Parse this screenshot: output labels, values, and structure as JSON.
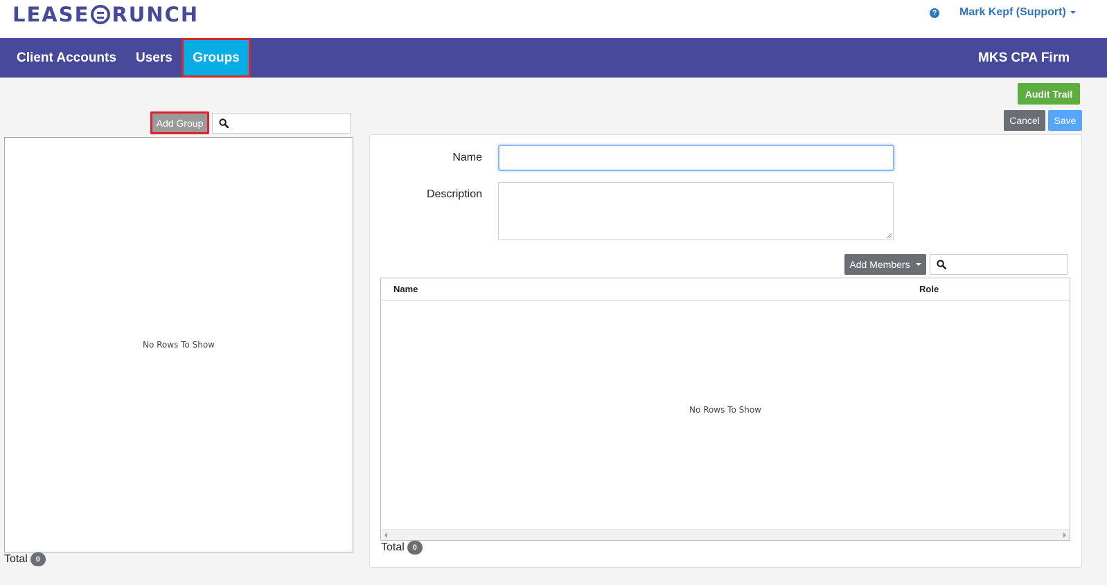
{
  "header": {
    "logo_left": "LEASE",
    "logo_right": "RUNCH",
    "help_icon": "question-circle-icon",
    "help_glyph": "?",
    "user_label": "Mark Kepf (Support)"
  },
  "nav": {
    "items": [
      {
        "label": "Client Accounts"
      },
      {
        "label": "Users"
      },
      {
        "label": "Groups",
        "active": true
      }
    ],
    "firm_name": "MKS CPA Firm"
  },
  "toolbar": {
    "audit_trail": "Audit Trail",
    "cancel": "Cancel",
    "save": "Save"
  },
  "groups_panel": {
    "add_group": "Add Group",
    "search_value": "",
    "empty_message": "No Rows To Show",
    "total_label": "Total",
    "total_count": "0"
  },
  "group_form": {
    "name_label": "Name",
    "name_value": "",
    "description_label": "Description",
    "description_value": ""
  },
  "members": {
    "add_members": "Add Members",
    "search_value": "",
    "columns": [
      "Name",
      "Role"
    ],
    "empty_message": "No Rows To Show",
    "total_label": "Total",
    "total_count": "0"
  },
  "colors": {
    "nav_background": "#474a9a",
    "active_tab": "#06aee5",
    "highlight_border": "#e0202a",
    "audit_green": "#5cae3f",
    "save_blue": "#56a6ff",
    "link_blue": "#2f74c0"
  }
}
